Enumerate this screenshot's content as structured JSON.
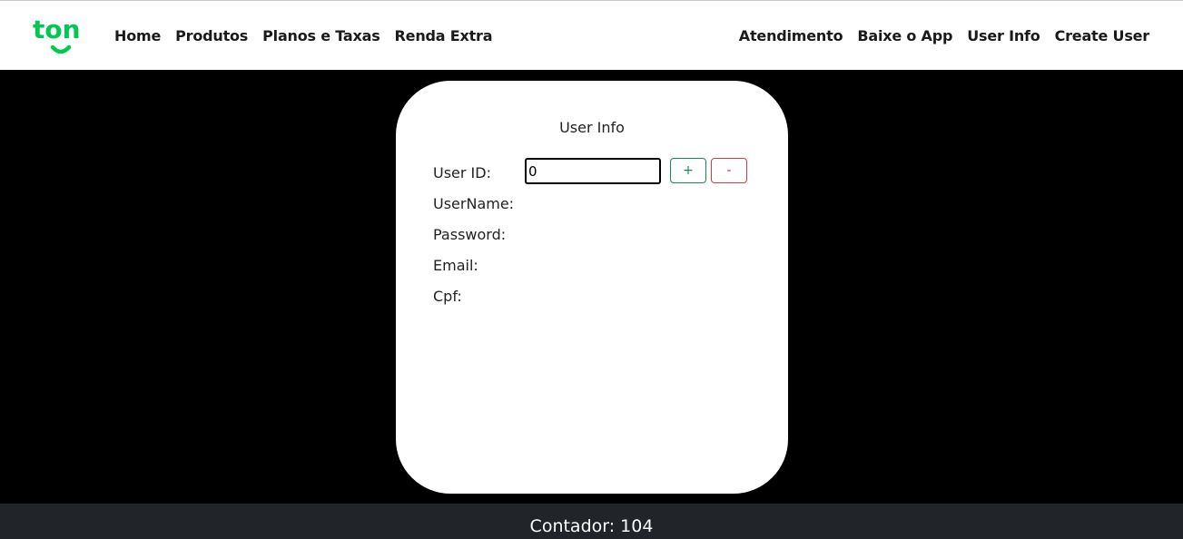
{
  "brand": {
    "logo_text": "ton",
    "icon": "ton-logo-icon",
    "color": "#00c853"
  },
  "nav": {
    "left": [
      {
        "label": "Home"
      },
      {
        "label": "Produtos"
      },
      {
        "label": "Planos e Taxas"
      },
      {
        "label": "Renda Extra"
      }
    ],
    "right": [
      {
        "label": "Atendimento"
      },
      {
        "label": "Baixe o App"
      },
      {
        "label": "User Info"
      },
      {
        "label": "Create User"
      }
    ]
  },
  "card": {
    "title": "User Info",
    "fields": {
      "user_id": {
        "label": "User ID:",
        "value": "0"
      },
      "username": {
        "label": "UserName:"
      },
      "password": {
        "label": "Password:"
      },
      "email": {
        "label": "Email:"
      },
      "cpf": {
        "label": "Cpf:"
      }
    },
    "buttons": {
      "increment": "+",
      "decrement": "-"
    }
  },
  "footer": {
    "counter_label": "Contador: 104"
  },
  "colors": {
    "success": "#198754",
    "danger": "#dc3545",
    "footer_bg": "#212529"
  }
}
